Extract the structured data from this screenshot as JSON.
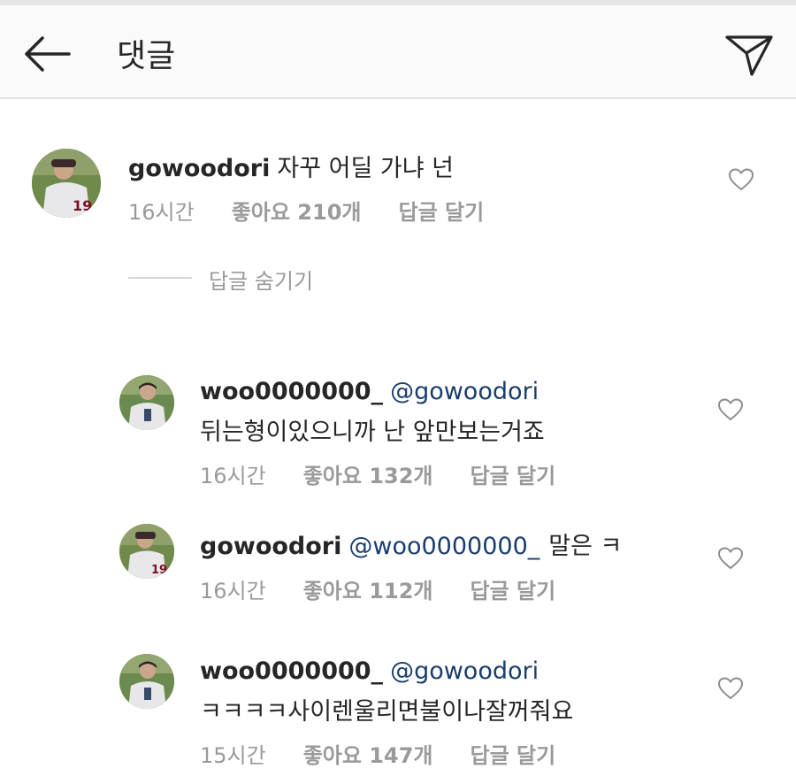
{
  "header": {
    "title": "댓글",
    "back_icon": "arrow-left-icon",
    "share_icon": "send-icon"
  },
  "comments": [
    {
      "username": "gowoodori",
      "mention": "",
      "text": "자꾸 어딜 가냐 넌",
      "time": "16시간",
      "likes": "좋아요 210개",
      "reply": "답글 달기"
    }
  ],
  "hide_replies": "답글 숨기기",
  "replies": [
    {
      "username": "woo0000000_",
      "mention": "@gowoodori",
      "text": "뒤는형이있으니까 난 앞만보는거죠",
      "time": "16시간",
      "likes": "좋아요 132개",
      "reply": "답글 달기"
    },
    {
      "username": "gowoodori",
      "mention": "@woo0000000_",
      "text": "말은 ㅋ",
      "time": "16시간",
      "likes": "좋아요 112개",
      "reply": "답글 달기"
    },
    {
      "username": "woo0000000_",
      "mention": "@gowoodori",
      "text": "ㅋㅋㅋㅋ사이렌울리면불이나잘꺼줘요",
      "time": "15시간",
      "likes": "좋아요 147개",
      "reply": "답글 달기"
    }
  ]
}
